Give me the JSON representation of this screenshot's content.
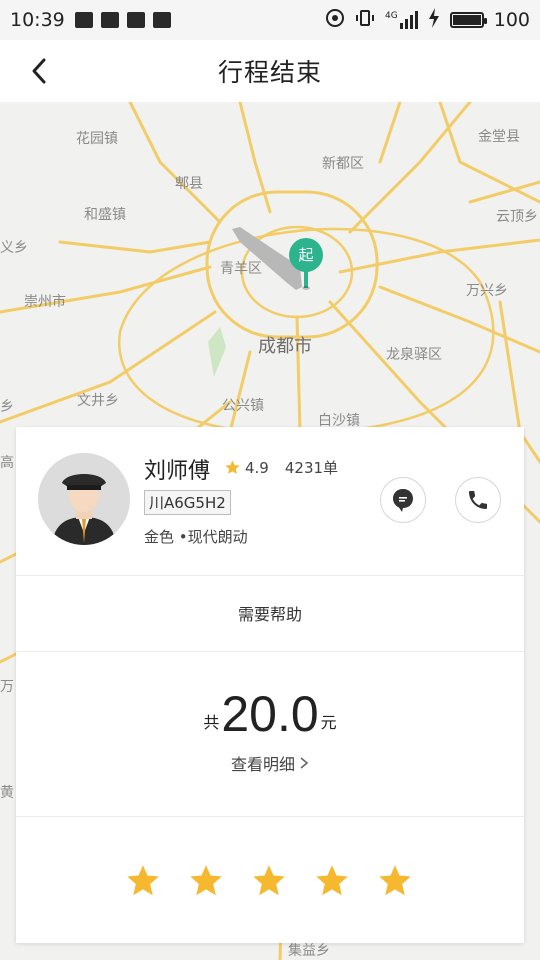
{
  "status_bar": {
    "time": "10:39",
    "network": "4G",
    "battery": "100",
    "battery_level": 1.0
  },
  "header": {
    "title": "行程结束"
  },
  "map": {
    "start_marker": "起",
    "places": {
      "huayuan": "花园镇",
      "jintang": "金堂县",
      "xindu": "新都区",
      "pixian": "郫县",
      "desheng": "和盛镇",
      "yunding": "云顶乡",
      "yixiang": "义乡",
      "qingyang": "青羊区",
      "wanxing": "万兴乡",
      "chongzhou": "崇州市",
      "chengdu": "成都市",
      "longquanyi": "龙泉驿区",
      "xiang": "乡",
      "wenjing": "文井乡",
      "gongxing": "公兴镇",
      "baisha": "白沙镇",
      "gao": "高",
      "wan": "万",
      "huang": "黄",
      "ji": "集益乡"
    }
  },
  "driver": {
    "name": "刘师傅",
    "rating": "4.9",
    "orders": "4231单",
    "plate": "川A6G5H2",
    "car": "金色 •现代朗动"
  },
  "help": {
    "label": "需要帮助"
  },
  "fare": {
    "prefix": "共",
    "amount": "20.0",
    "unit": "元",
    "detail_label": "查看明细"
  },
  "rating_stars": {
    "count": 5,
    "selected": 5,
    "color": "#f5b82e"
  },
  "colors": {
    "accent_green": "#2db48f",
    "star": "#f5b82e",
    "road": "#f2c94c"
  }
}
